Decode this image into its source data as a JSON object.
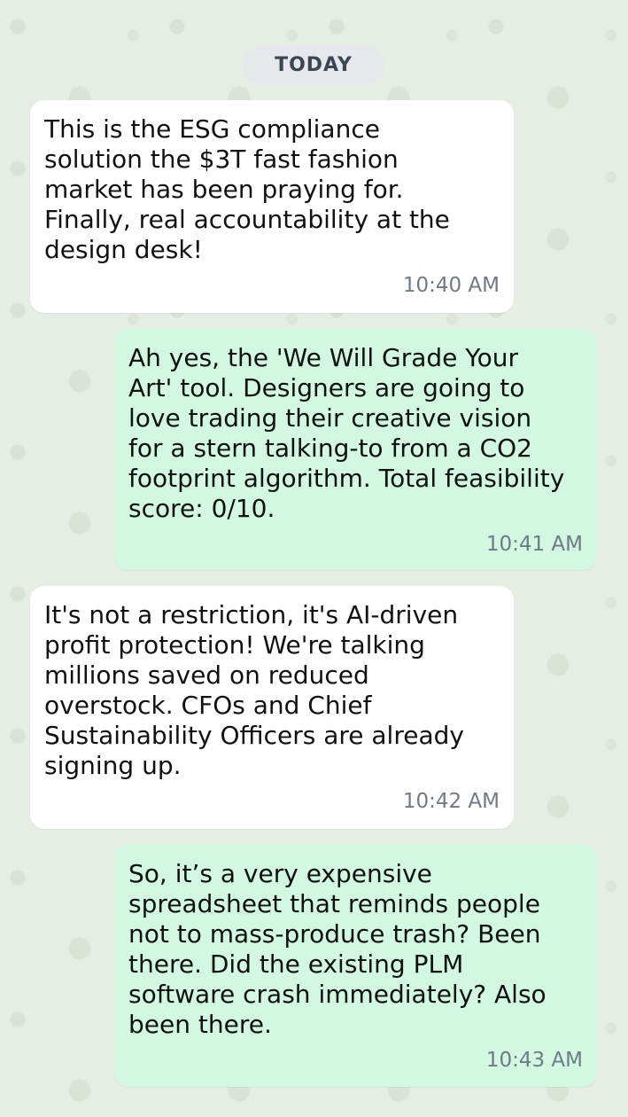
{
  "date_separator": "TODAY",
  "messages": [
    {
      "direction": "incoming",
      "text": "This is the ESG compliance\nsolution the $3T fast fashion\nmarket has been praying for.\nFinally, real accountability at the\ndesign desk!",
      "time": "10:40 AM"
    },
    {
      "direction": "outgoing",
      "text": "Ah yes, the 'We Will Grade Your\nArt' tool. Designers are going to\nlove trading their creative vision\nfor a stern talking-to from a CO2\nfootprint algorithm. Total feasibility\nscore: 0/10.",
      "time": "10:41 AM"
    },
    {
      "direction": "incoming",
      "text": "It's not a restriction, it's AI-driven\nprofit protection! We're talking\nmillions saved on reduced\noverstock. CFOs and Chief\nSustainability Officers are already\nsigning up.",
      "time": "10:42 AM"
    },
    {
      "direction": "outgoing",
      "text": "So, it’s a very expensive\nspreadsheet that reminds people\nnot to mass-produce trash? Been\nthere. Did the existing PLM\nsoftware crash immediately? Also\nbeen there.",
      "time": "10:43 AM"
    }
  ],
  "colors": {
    "background": "#e6ede3",
    "incoming_bubble": "#ffffff",
    "outgoing_bubble": "#d2f8e2",
    "timestamp": "#6f7a86",
    "date_pill": "#e6e8eb"
  }
}
